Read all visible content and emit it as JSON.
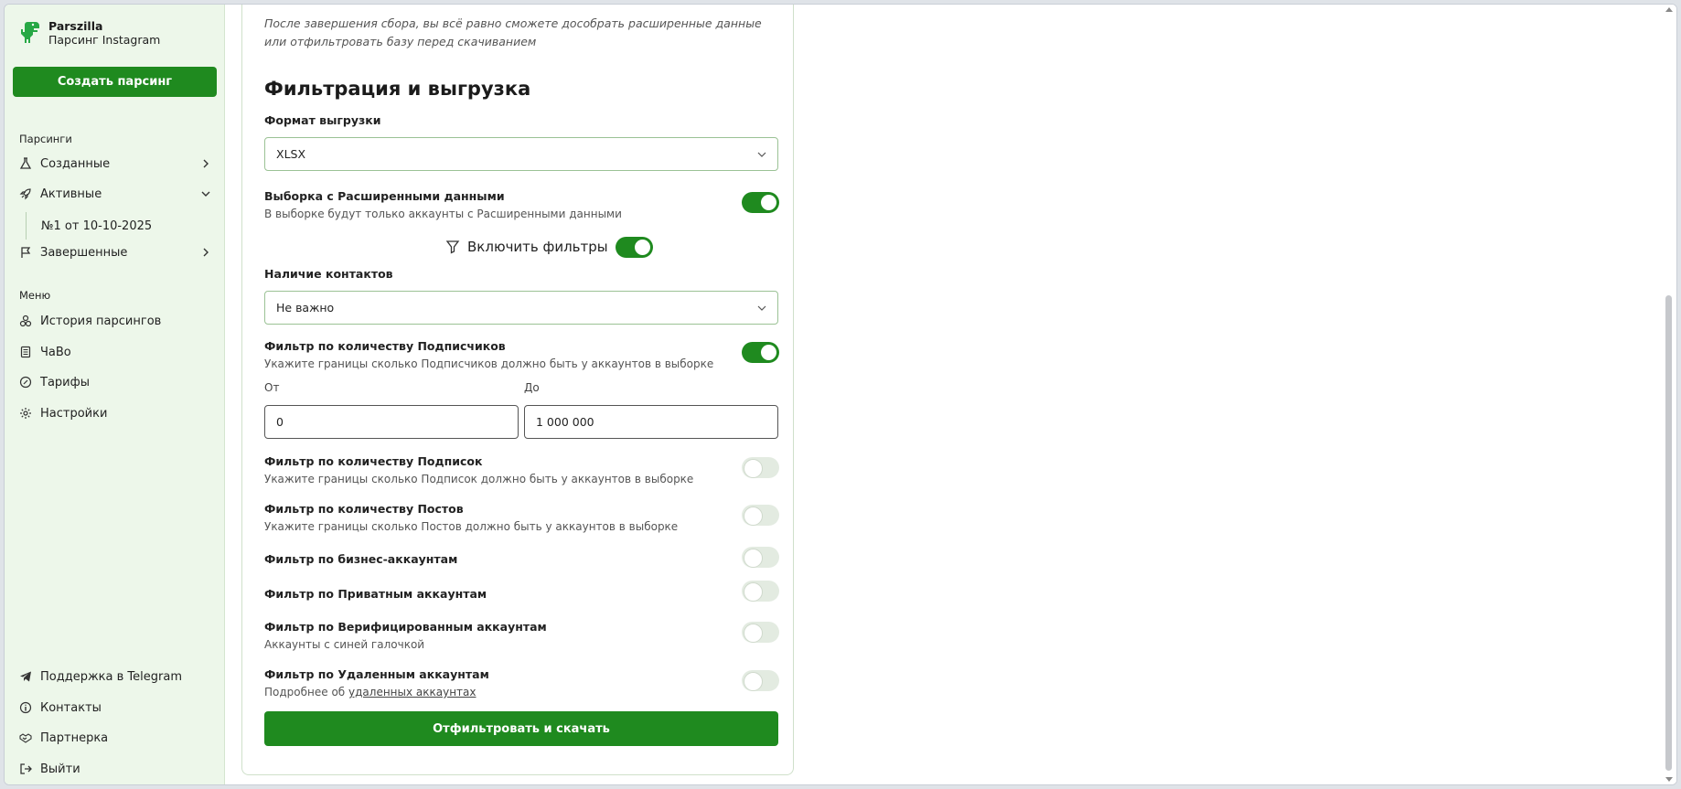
{
  "sidebar": {
    "logo": {
      "name": "Parszilla",
      "subtitle": "Парсинг Instagram"
    },
    "create_button": "Создать парсинг",
    "section_parsings": "Парсинги",
    "parsings": [
      {
        "label": "Созданные",
        "icon": "flask-icon"
      },
      {
        "label": "Активные",
        "icon": "rocket-icon"
      },
      {
        "label": "Завершенные",
        "icon": "flag-icon"
      }
    ],
    "active_sub": "№1 от 10-10-2025",
    "section_menu": "Меню",
    "menu": [
      {
        "label": "История парсингов",
        "icon": "history-icon"
      },
      {
        "label": "ЧаВо",
        "icon": "faq-icon"
      },
      {
        "label": "Тарифы",
        "icon": "tariff-icon"
      },
      {
        "label": "Настройки",
        "icon": "gear-icon"
      }
    ],
    "bottom": [
      {
        "label": "Поддержка в Telegram",
        "icon": "telegram-icon"
      },
      {
        "label": "Контакты",
        "icon": "info-icon"
      },
      {
        "label": "Партнерка",
        "icon": "handshake-icon"
      },
      {
        "label": "Выйти",
        "icon": "logout-icon"
      }
    ]
  },
  "main": {
    "note": "После завершения сбора, вы всё равно сможете дособрать расширенные данные или отфильтровать базу перед скачиванием",
    "heading": "Фильтрация и выгрузка",
    "format_label": "Формат выгрузки",
    "format_value": "XLSX",
    "extended": {
      "label": "Выборка с Расширенными данными",
      "desc": "В выборке будут только аккаунты с Расширенными данными",
      "on": true
    },
    "enable_filters_label": "Включить фильтры",
    "contacts_label": "Наличие контактов",
    "contacts_value": "Не важно",
    "followers": {
      "label": "Фильтр по количеству Подписчиков",
      "desc": "Укажите границы сколько Подписчиков должно быть у аккаунтов в выборке",
      "on": true,
      "from_label": "От",
      "from_value": "0",
      "to_label": "До",
      "to_value": "1 000 000"
    },
    "following": {
      "label": "Фильтр по количеству Подписок",
      "desc": "Укажите границы сколько Подписок должно быть у аккаунтов в выборке",
      "on": false
    },
    "posts": {
      "label": "Фильтр по количеству Постов",
      "desc": "Укажите границы сколько Постов должно быть у аккаунтов в выборке",
      "on": false
    },
    "business": {
      "label": "Фильтр по бизнес-аккаунтам",
      "on": false
    },
    "private": {
      "label": "Фильтр по Приватным аккаунтам",
      "on": false
    },
    "verified": {
      "label": "Фильтр по Верифицированным аккаунтам",
      "desc": "Аккаунты с синей галочкой",
      "on": false
    },
    "deleted": {
      "label": "Фильтр по Удаленным аккаунтам",
      "desc_prefix": "Подробнее об ",
      "desc_link": "удаленных аккаунтах",
      "on": false
    },
    "submit": "Отфильтровать и скачать"
  },
  "colors": {
    "accent": "#1f8a1f",
    "sidebar_bg": "#edf7ea"
  }
}
